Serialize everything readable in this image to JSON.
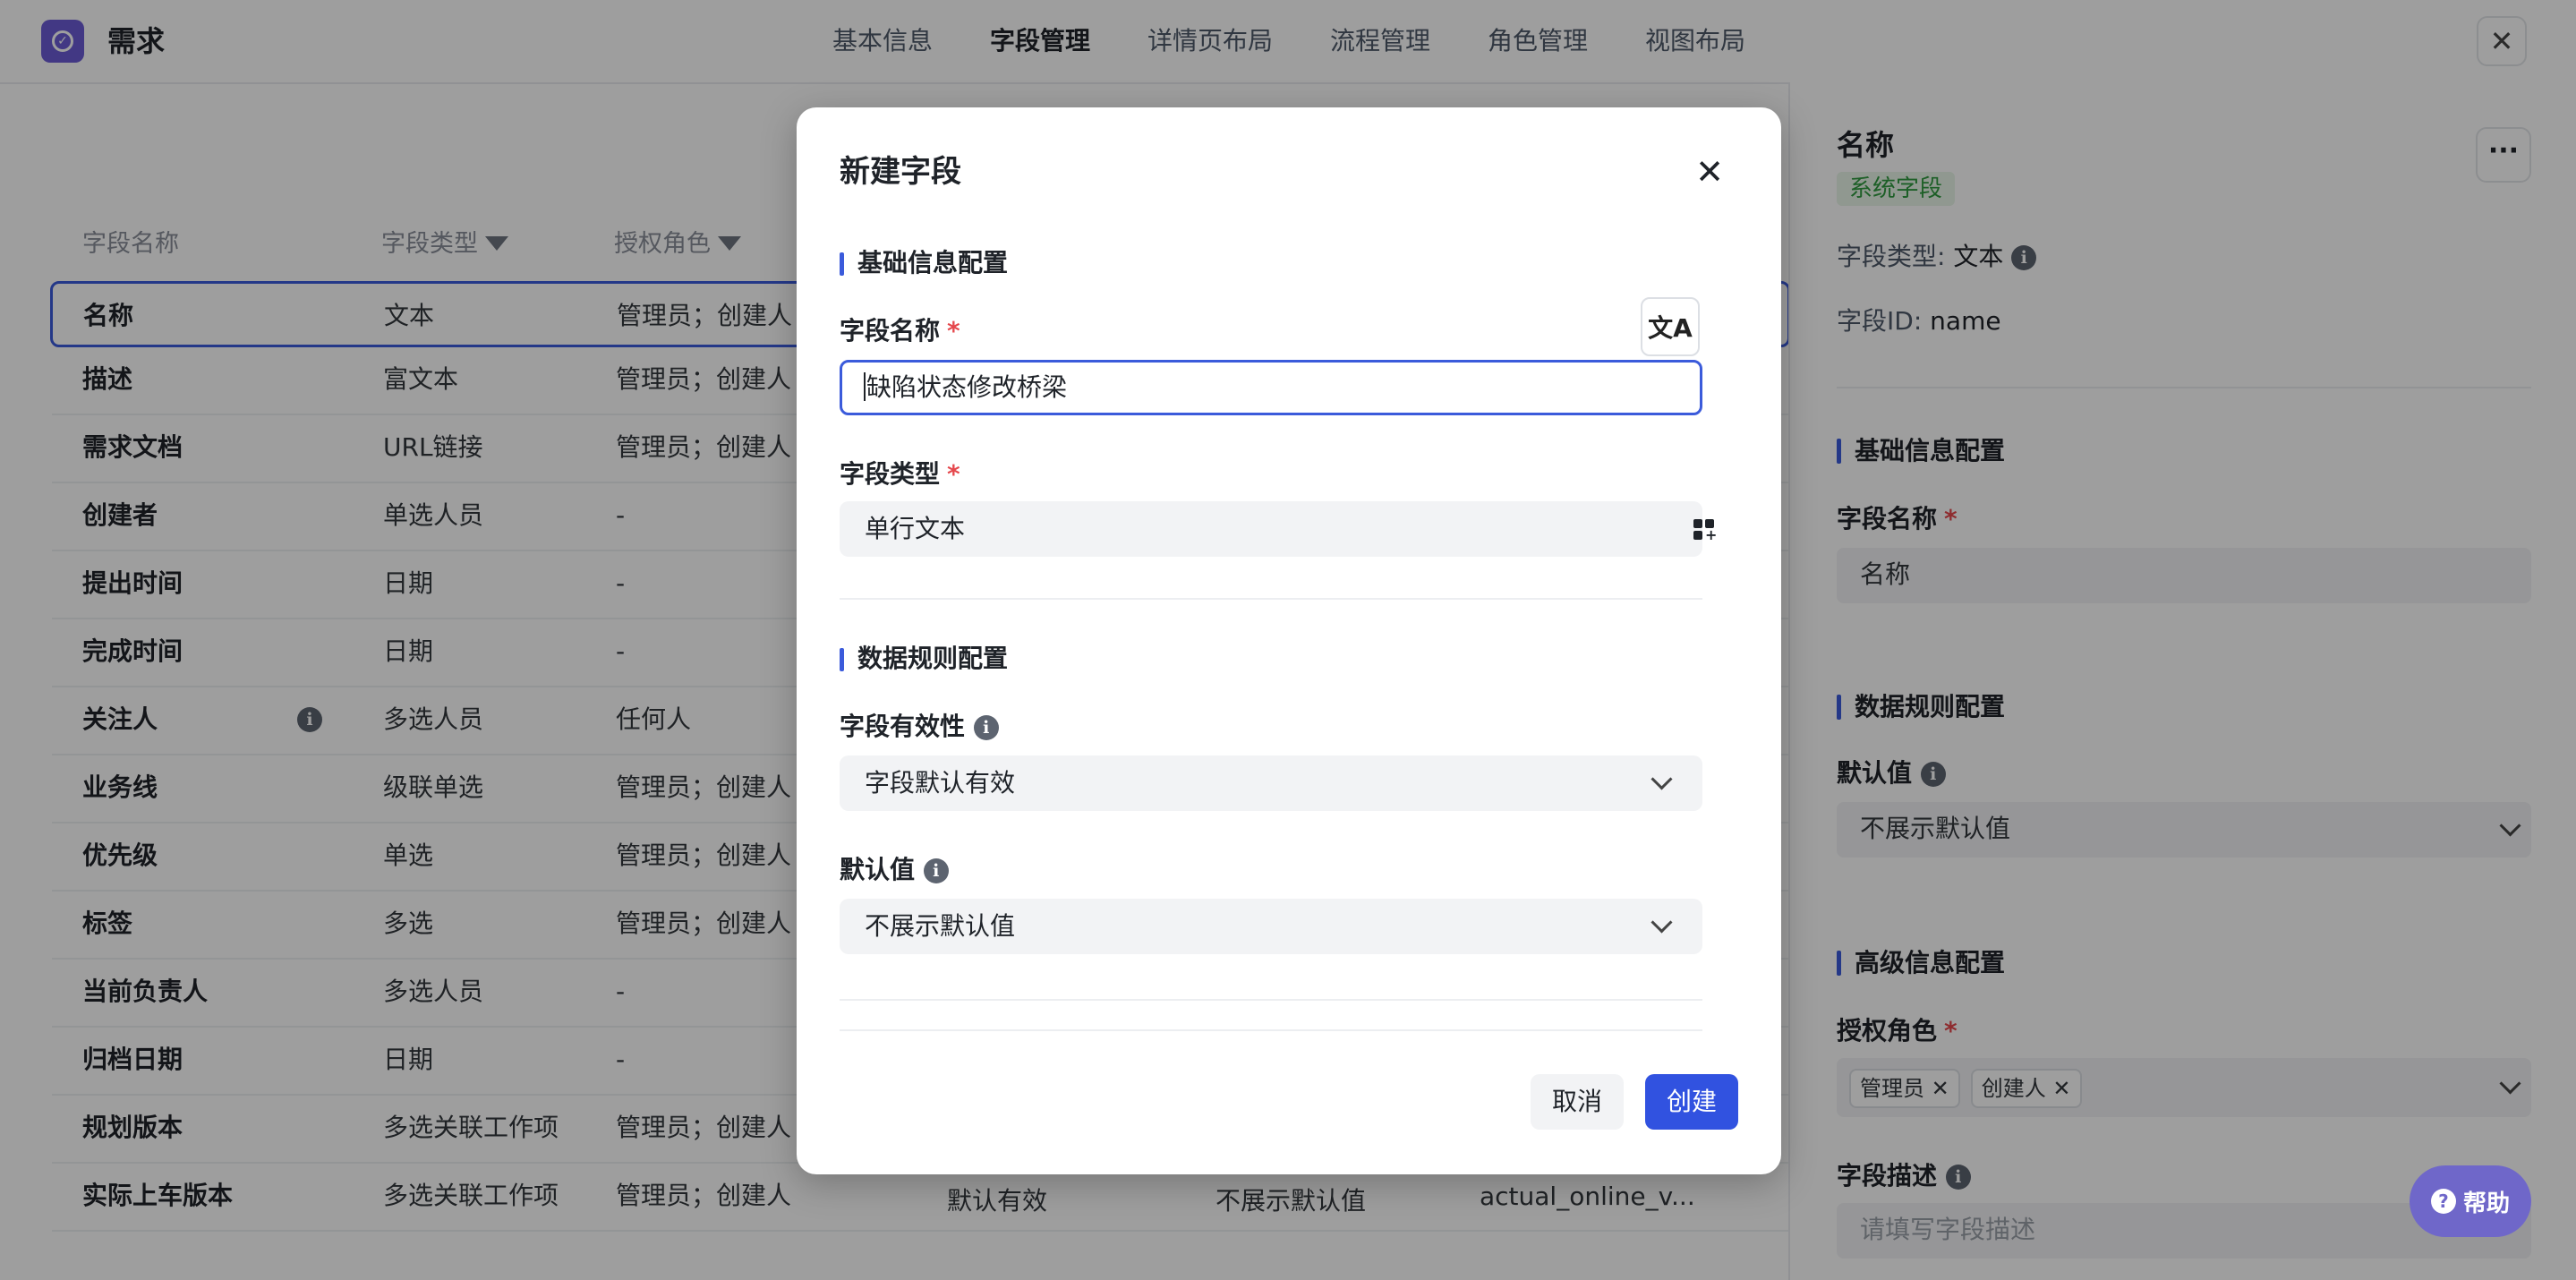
{
  "app": {
    "title": "需求"
  },
  "tabs": [
    "基本信息",
    "字段管理",
    "详情页布局",
    "流程管理",
    "角色管理",
    "视图布局"
  ],
  "active_tab": "字段管理",
  "table": {
    "headers": [
      "字段名称",
      "字段类型",
      "授权角色"
    ],
    "rows": [
      {
        "name": "名称",
        "type": "文本",
        "roles": "管理员；创建人"
      },
      {
        "name": "描述",
        "type": "富文本",
        "roles": "管理员；创建人"
      },
      {
        "name": "需求文档",
        "type": "URL链接",
        "roles": "管理员；创建人"
      },
      {
        "name": "创建者",
        "type": "单选人员",
        "roles": "-"
      },
      {
        "name": "提出时间",
        "type": "日期",
        "roles": "-"
      },
      {
        "name": "完成时间",
        "type": "日期",
        "roles": "-"
      },
      {
        "name": "关注人",
        "type": "多选人员",
        "roles": "任何人"
      },
      {
        "name": "业务线",
        "type": "级联单选",
        "roles": "管理员；创建人"
      },
      {
        "name": "优先级",
        "type": "单选",
        "roles": "管理员；创建人"
      },
      {
        "name": "标签",
        "type": "多选",
        "roles": "管理员；创建人"
      },
      {
        "name": "当前负责人",
        "type": "多选人员",
        "roles": "-"
      },
      {
        "name": "归档日期",
        "type": "日期",
        "roles": "-"
      },
      {
        "name": "规划版本",
        "type": "多选关联工作项",
        "roles": "管理员；创建人"
      },
      {
        "name": "实际上车版本",
        "type": "多选关联工作项",
        "roles": "管理员；创建人",
        "validity": "默认有效",
        "default": "不展示默认值",
        "id": "actual_online_v..."
      }
    ]
  },
  "panel": {
    "title": "名称",
    "badge": "系统字段",
    "type_label": "字段类型:",
    "type_value": "文本",
    "id_label": "字段ID:",
    "id_value": "name",
    "basic_section": "基础信息配置",
    "name_label": "字段名称",
    "name_value": "名称",
    "data_section": "数据规则配置",
    "default_label": "默认值",
    "default_value": "不展示默认值",
    "advanced_section": "高级信息配置",
    "roles_label": "授权角色",
    "roles": [
      "管理员",
      "创建人"
    ],
    "desc_label": "字段描述",
    "desc_placeholder": "请填写字段描述",
    "more_icon": "more-horizontal-icon"
  },
  "modal": {
    "title": "新建字段",
    "basic_section": "基础信息配置",
    "name_label": "字段名称",
    "name_value": "缺陷状态修改桥梁",
    "type_label": "字段类型",
    "type_value": "单行文本",
    "data_section": "数据规则配置",
    "validity_label": "字段有效性",
    "validity_value": "字段默认有效",
    "default_label": "默认值",
    "default_value": "不展示默认值",
    "cancel": "取消",
    "create": "创建",
    "required_mark": "*",
    "translate_icon": "translate-icon"
  },
  "help": {
    "label": "帮助"
  },
  "colors": {
    "accent": "#3152e0",
    "logo": "#6b5bd6",
    "badge_green": "#2f9a3f",
    "help": "#6f67c9"
  }
}
